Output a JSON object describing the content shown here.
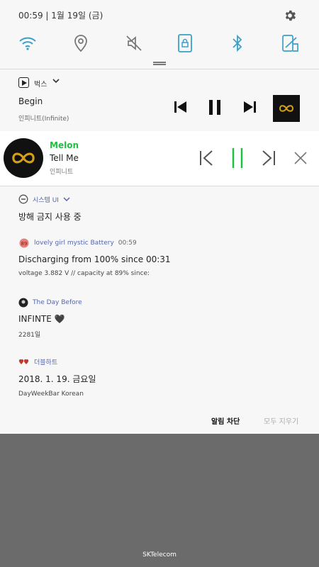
{
  "status_bar": {
    "time_date": "00:59  |  1월 19일 (금)"
  },
  "quick_settings": {
    "toggles": [
      "wifi-icon",
      "location-icon",
      "mute-icon",
      "screen-lock-icon",
      "bluetooth-icon",
      "signal-icon"
    ],
    "accent_color": "#3aa0c8"
  },
  "bugs_player": {
    "app_name": "벅스",
    "song": "Begin",
    "artist": "인피니트(Infinite)"
  },
  "melon_player": {
    "brand": "Melon",
    "song": "Tell Me",
    "artist": "인피니트",
    "accent_color": "#1fbf3f"
  },
  "notifications": [
    {
      "app": "시스템 UI",
      "title": "방해 금지 사용 중"
    },
    {
      "app": "lovely girl mystic Battery",
      "time": "00:59",
      "title": "Discharging from 100% since 00:31",
      "sub": "voltage 3.882 V // capacity at 89% since:"
    },
    {
      "app": "The Day Before",
      "title": "INFINTE 🖤",
      "sub": "2281일"
    },
    {
      "app": "더블하트",
      "title": "2018. 1. 19. 금요일",
      "sub": "DayWeekBar Korean"
    }
  ],
  "actions": {
    "block": "알림 차단",
    "clear_all": "모두 지우기"
  },
  "carrier": "SKTelecom"
}
